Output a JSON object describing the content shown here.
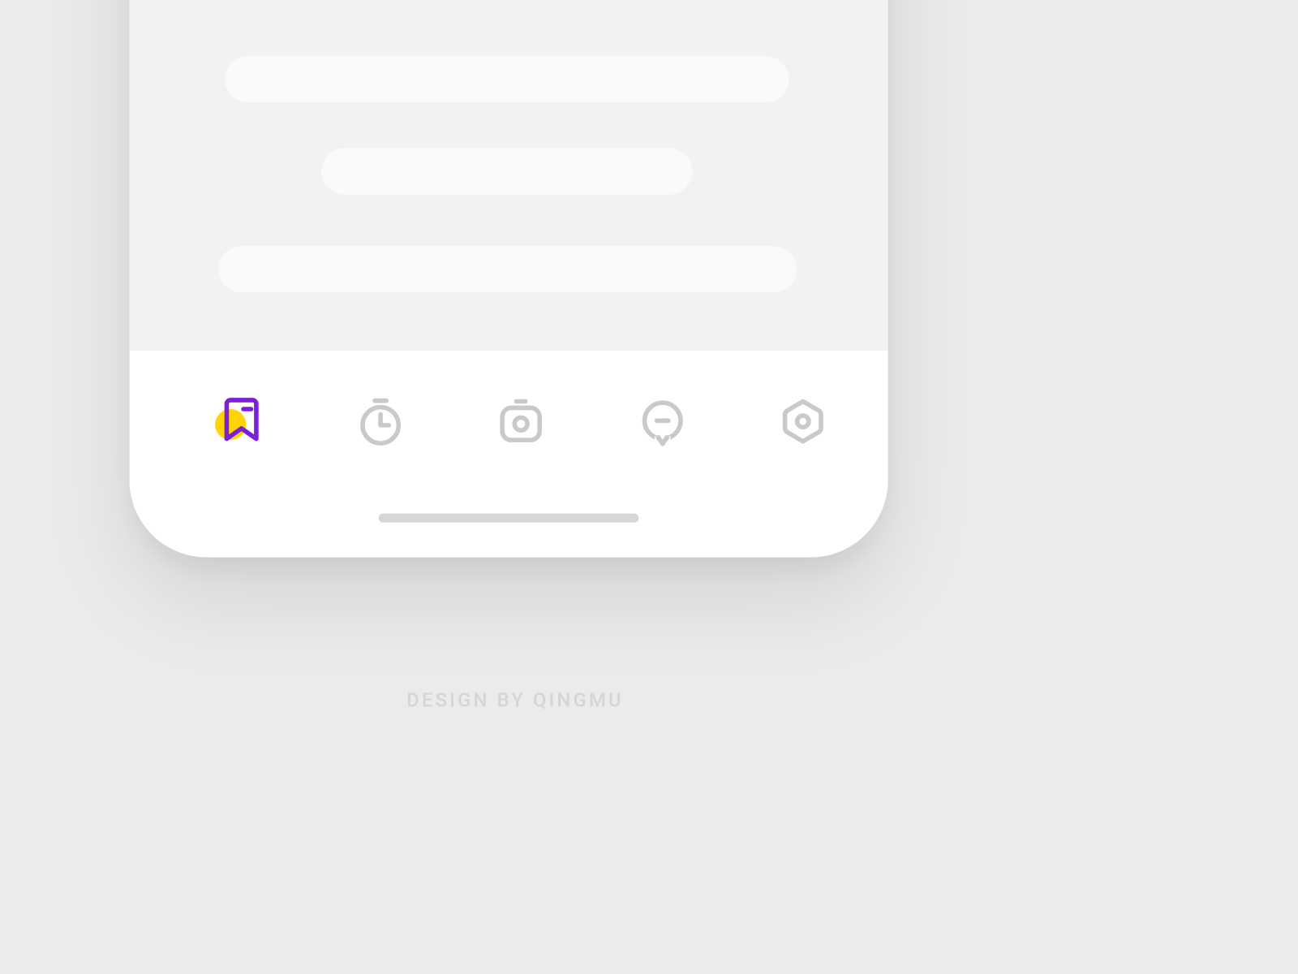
{
  "colors": {
    "background": "#ebebeb",
    "phone": "#ffffff",
    "content_area": "#f2f2f2",
    "skeleton": "#fafafa",
    "inactive_icon": "#c9c9c9",
    "home_indicator": "#d6d6d6",
    "credit_text": "#d5d5d5",
    "accent_stroke": "#7b1fd9",
    "accent_fill": "#ffd400"
  },
  "tabs": {
    "active_index": 0,
    "items": [
      {
        "icon": "bookmark-icon"
      },
      {
        "icon": "stopwatch-icon"
      },
      {
        "icon": "camera-icon"
      },
      {
        "icon": "chat-icon"
      },
      {
        "icon": "settings-hex-icon"
      }
    ]
  },
  "credit": "DESIGN BY QINGMU"
}
